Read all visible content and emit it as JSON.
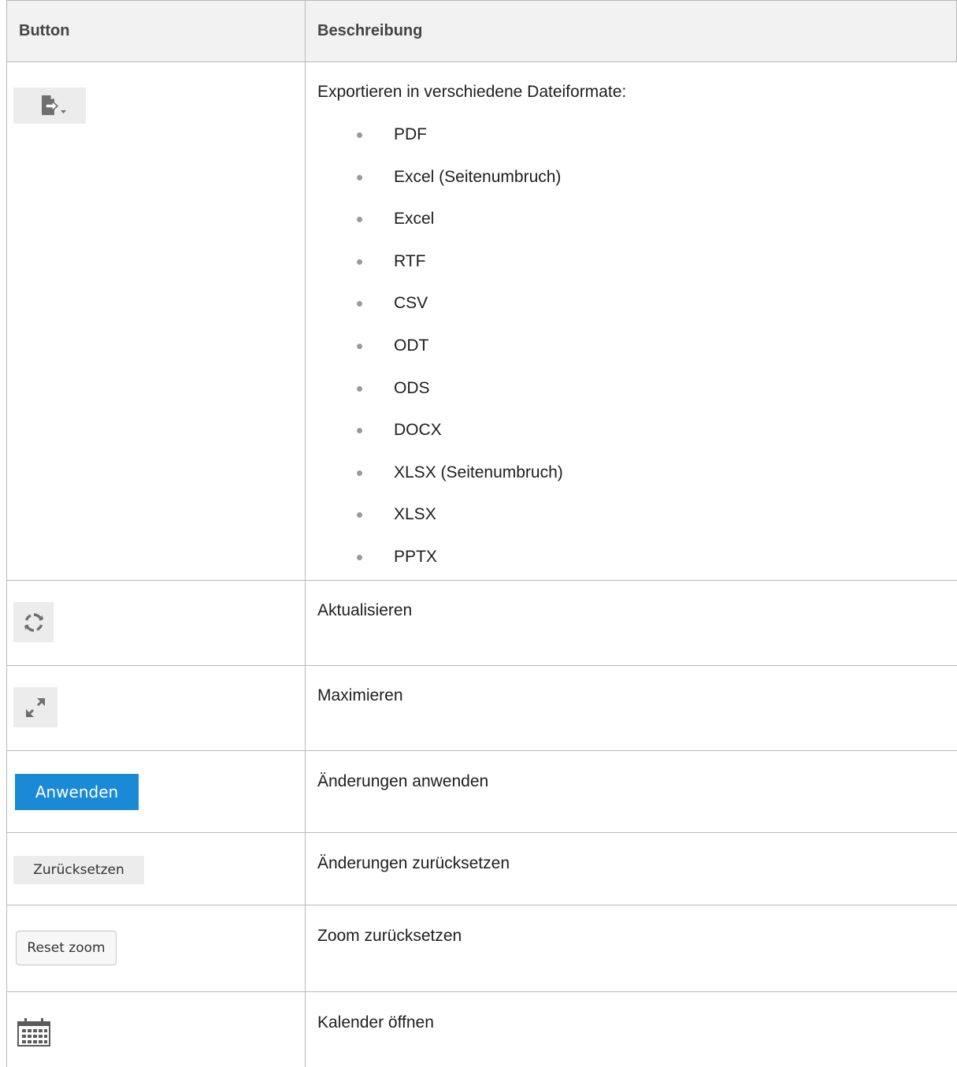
{
  "table": {
    "headers": {
      "button": "Button",
      "description": "Beschreibung"
    },
    "rows": [
      {
        "icon": "export-icon",
        "description": "Exportieren in verschiedene Dateiformate:",
        "formats": [
          "PDF",
          "Excel (Seitenumbruch)",
          "Excel",
          "RTF",
          "CSV",
          "ODT",
          "ODS",
          "DOCX",
          "XLSX (Seitenumbruch)",
          "XLSX",
          "PPTX"
        ]
      },
      {
        "icon": "refresh-icon",
        "description": "Aktualisieren"
      },
      {
        "icon": "maximize-icon",
        "description": "Maximieren"
      },
      {
        "button_label": "Anwenden",
        "description": "Änderungen anwenden"
      },
      {
        "button_label": "Zurücksetzen",
        "description": "Änderungen zurücksetzen"
      },
      {
        "button_label": "Reset zoom",
        "description": "Zoom zurücksetzen"
      },
      {
        "icon": "calendar-icon",
        "description": "Kalender öffnen"
      }
    ]
  },
  "colors": {
    "apply_button": "#1a8ad6",
    "header_background": "#f2f2f2",
    "grid_lines": "#b8b8b8",
    "icon_gray": "#6f6f6f"
  }
}
